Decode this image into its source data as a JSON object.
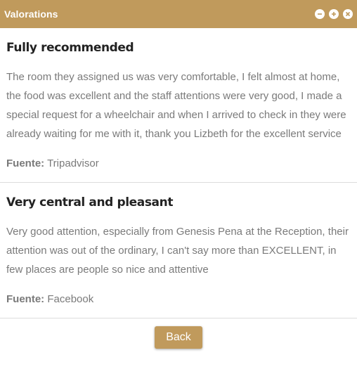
{
  "window": {
    "title": "Valorations",
    "controls": [
      "minus-icon",
      "plus-icon",
      "close-icon"
    ]
  },
  "reviews": [
    {
      "title": "Fully recommended",
      "text": "The room they assigned us was very comfortable, I felt almost at home, the food was excellent and the staff attentions were very good, I made a special request for a wheelchair and when I arrived to check in they were already waiting for me with it, thank you Lizbeth for the excellent service",
      "source_label": "Fuente:",
      "source": "Tripadvisor"
    },
    {
      "title": "Very central and pleasant",
      "text": "Very good attention, especially from Genesis Pena at the Reception, their attention was out of the ordinary, I can't say more than EXCELLENT, in few places are people so nice and attentive",
      "source_label": "Fuente:",
      "source": "Facebook"
    }
  ],
  "footer": {
    "back_label": "Back"
  },
  "colors": {
    "accent": "#c09a5c",
    "text_muted": "#7a7a7a",
    "heading": "#222222"
  }
}
